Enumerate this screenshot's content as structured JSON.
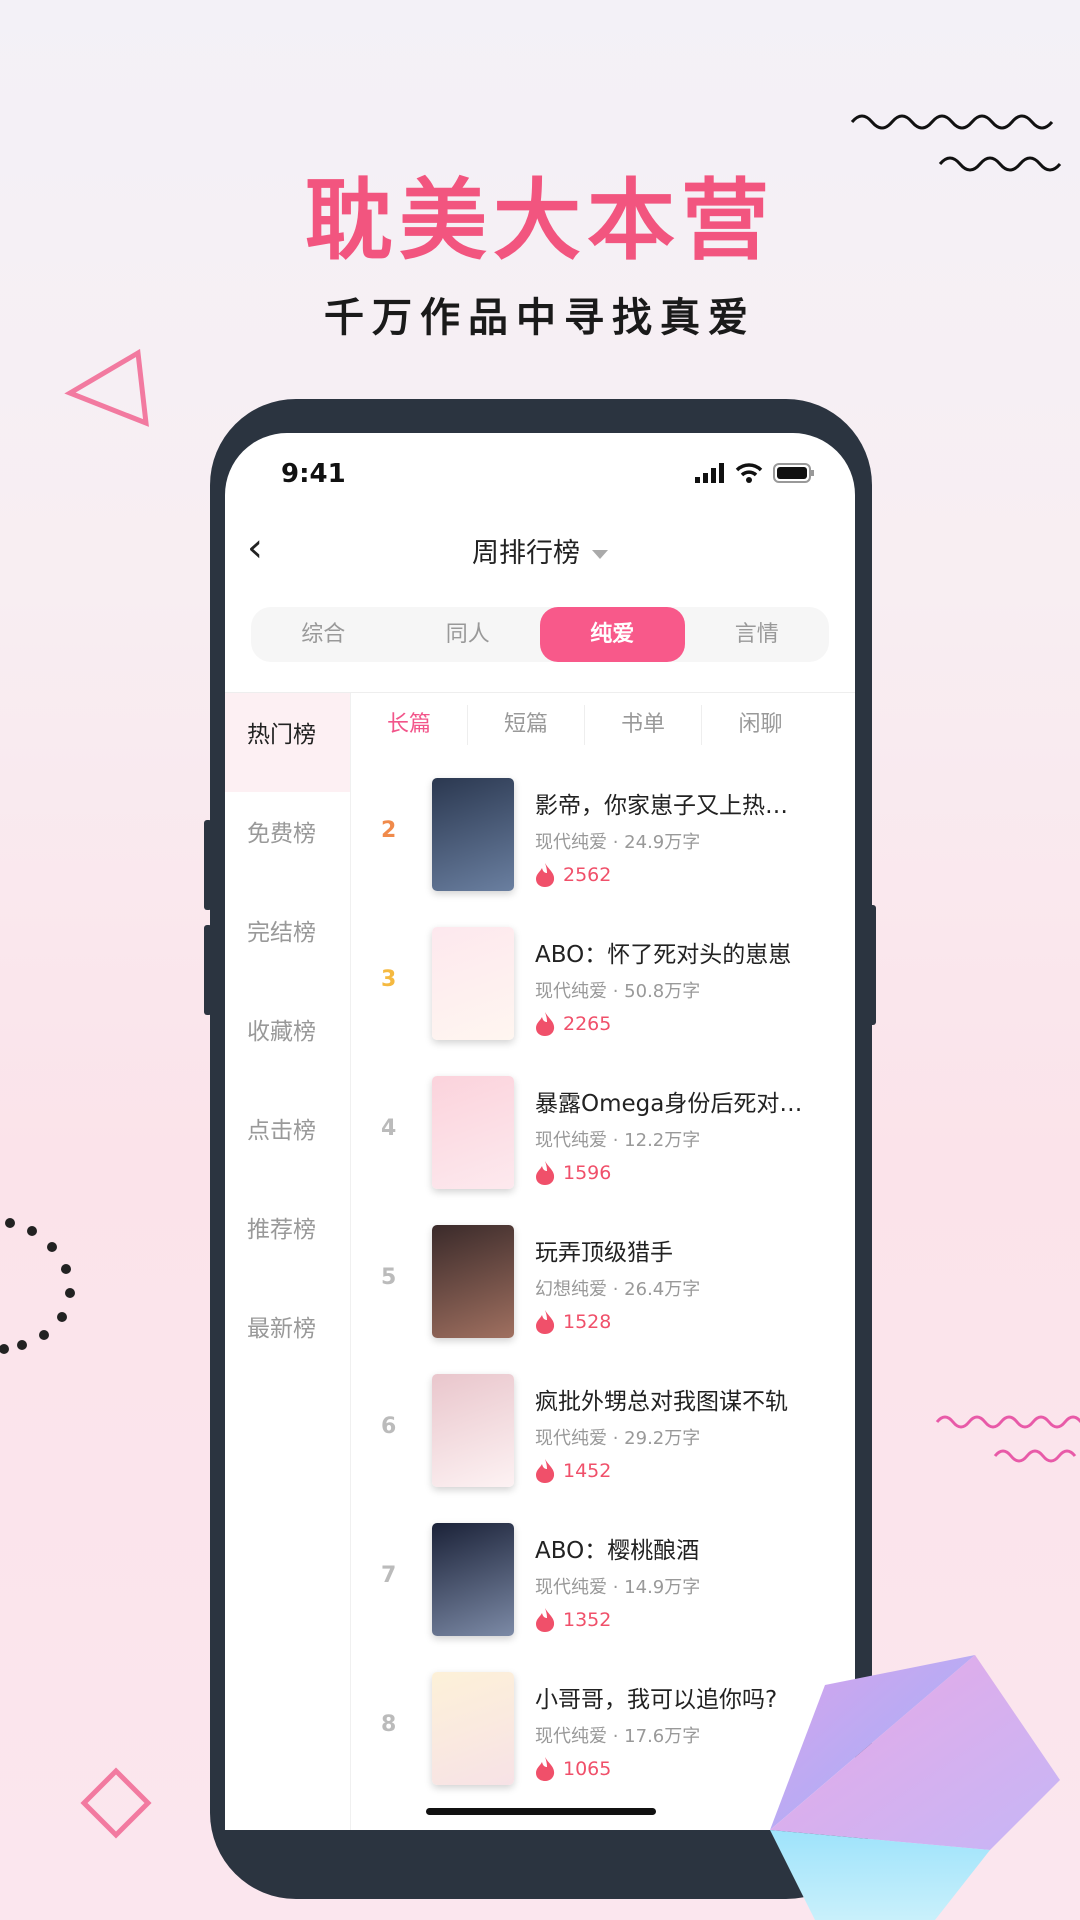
{
  "promo": {
    "title": "耽美大本营",
    "subtitle": "千万作品中寻找真爱"
  },
  "status": {
    "time": "9:41"
  },
  "header": {
    "title": "周排行榜"
  },
  "categories": [
    {
      "label": "综合"
    },
    {
      "label": "同人"
    },
    {
      "label": "纯爱",
      "active": true
    },
    {
      "label": "言情"
    }
  ],
  "sidebar": [
    {
      "label": "热门榜",
      "active": true
    },
    {
      "label": "免费榜"
    },
    {
      "label": "完结榜"
    },
    {
      "label": "收藏榜"
    },
    {
      "label": "点击榜"
    },
    {
      "label": "推荐榜"
    },
    {
      "label": "最新榜"
    }
  ],
  "subtabs": [
    {
      "label": "长篇",
      "active": true
    },
    {
      "label": "短篇"
    },
    {
      "label": "书单"
    },
    {
      "label": "闲聊"
    }
  ],
  "colors": {
    "accent": "#f8598a",
    "heat": "#f0506a",
    "rank2": "#f08a4b",
    "rank3": "#f5b940"
  },
  "books": [
    {
      "rank": "2",
      "title": "影帝，你家崽子又上热…",
      "genre": "现代纯爱",
      "words": "24.9万字",
      "heat": "2562",
      "cover": [
        "#2b3850",
        "#6a7fa0"
      ]
    },
    {
      "rank": "3",
      "title": "ABO：怀了死对头的崽崽",
      "genre": "现代纯爱",
      "words": "50.8万字",
      "heat": "2265",
      "cover": [
        "#fde8ee",
        "#fff6f0"
      ]
    },
    {
      "rank": "4",
      "title": "暴露Omega身份后死对…",
      "genre": "现代纯爱",
      "words": "12.2万字",
      "heat": "1596",
      "cover": [
        "#fbd3dc",
        "#fde9ee"
      ]
    },
    {
      "rank": "5",
      "title": "玩弄顶级猎手",
      "genre": "幻想纯爱",
      "words": "26.4万字",
      "heat": "1528",
      "cover": [
        "#3a2a2a",
        "#a07060"
      ]
    },
    {
      "rank": "6",
      "title": "疯批外甥总对我图谋不轨",
      "genre": "现代纯爱",
      "words": "29.2万字",
      "heat": "1452",
      "cover": [
        "#e9c6cc",
        "#fdf2f3"
      ]
    },
    {
      "rank": "7",
      "title": "ABO：樱桃酿酒",
      "genre": "现代纯爱",
      "words": "14.9万字",
      "heat": "1352",
      "cover": [
        "#1b2238",
        "#7c8aa6"
      ]
    },
    {
      "rank": "8",
      "title": "小哥哥，我可以追你吗?",
      "genre": "现代纯爱",
      "words": "17.6万字",
      "heat": "1065",
      "cover": [
        "#fdf1d8",
        "#f7e2e6"
      ]
    }
  ]
}
